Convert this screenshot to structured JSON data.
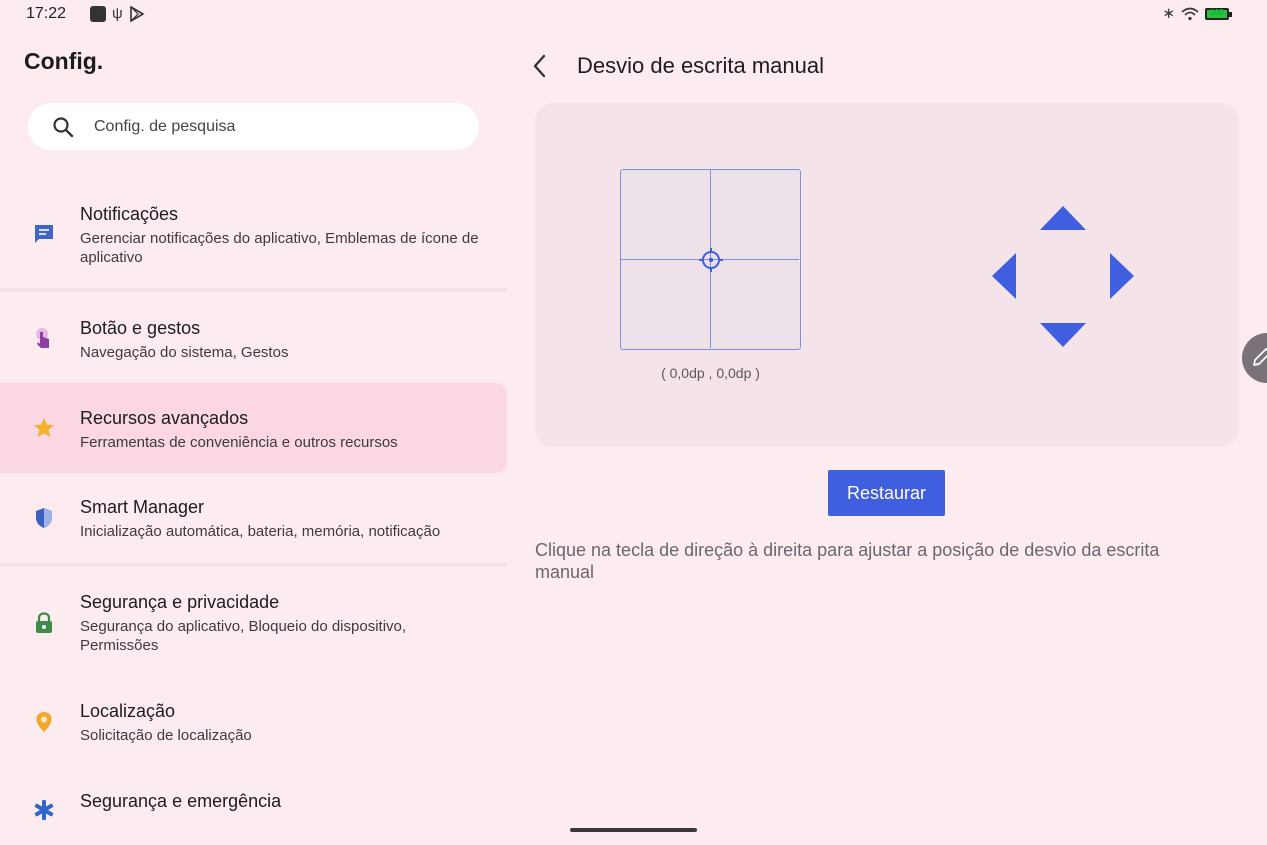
{
  "status_bar": {
    "time": "17:22",
    "battery_level": "100"
  },
  "settings": {
    "title": "Config.",
    "search": {
      "placeholder": "Config. de pesquisa"
    },
    "items": [
      {
        "title": "Notificações",
        "subtitle": "Gerenciar notificações do aplicativo, Emblemas de ícone de aplicativo",
        "icon": "notifications-icon",
        "color": "#3f65c8"
      },
      {
        "title": "Botão e gestos",
        "subtitle": "Navegação do sistema, Gestos",
        "icon": "gesture-icon",
        "color": "#8e3fa6"
      },
      {
        "title": "Recursos avançados",
        "subtitle": "Ferramentas de conveniência e outros recursos",
        "icon": "star-icon",
        "color": "#f2b02c"
      },
      {
        "title": "Smart Manager",
        "subtitle": "Inicialização automática, bateria, memória, notificação",
        "icon": "shield-icon",
        "color": "#3c5fc2"
      },
      {
        "title": "Segurança e privacidade",
        "subtitle": "Segurança do aplicativo, Bloqueio do dispositivo, Permissões",
        "icon": "lock-icon",
        "color": "#3e8a48"
      },
      {
        "title": "Localização",
        "subtitle": "Solicitação de localização",
        "icon": "location-pin-icon",
        "color": "#f2a82c"
      },
      {
        "title": "Segurança e emergência",
        "subtitle": "",
        "icon": "emergency-icon",
        "color": "#2d67c8"
      }
    ]
  },
  "detail": {
    "title": "Desvio de escrita manual",
    "coordinates": "( 0,0dp , 0,0dp )",
    "restore_label": "Restaurar",
    "hint": "Clique na tecla de direção à direita para ajustar a posição de desvio da escrita manual",
    "accent_color": "#3f5ee0"
  }
}
